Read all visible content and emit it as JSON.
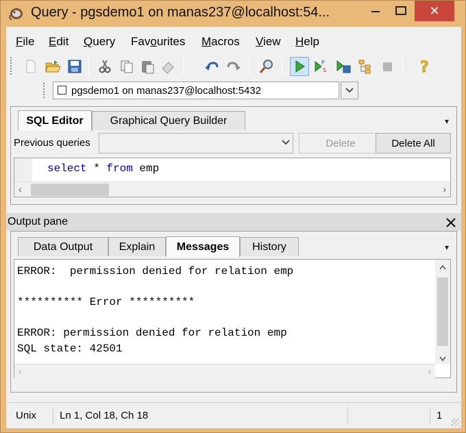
{
  "window": {
    "title": "Query - pgsdemo1 on manas237@localhost:54...",
    "controls": {
      "minimize": "—",
      "maximize": "☐",
      "close": "✕"
    }
  },
  "menu": [
    {
      "label": "File",
      "mnemonic": "F",
      "rest": "ile"
    },
    {
      "label": "Edit",
      "mnemonic": "E",
      "rest": "dit"
    },
    {
      "label": "Query",
      "mnemonic": "Q",
      "rest": "uery"
    },
    {
      "label": "Favourites",
      "pre": "Fav",
      "mnemonic": "o",
      "rest": "urites"
    },
    {
      "label": "Macros",
      "mnemonic": "M",
      "rest": "acros"
    },
    {
      "label": "View",
      "mnemonic": "V",
      "rest": "iew"
    },
    {
      "label": "Help",
      "mnemonic": "H",
      "rest": "elp"
    }
  ],
  "toolbar": {
    "icons": [
      "new-icon",
      "open-folder-icon",
      "save-icon",
      "cut-icon",
      "copy-icon",
      "paste-icon",
      "clear-icon",
      "undo-icon",
      "redo-icon",
      "find-icon",
      "execute-icon",
      "execute-pgscript-icon",
      "execute-to-file-icon",
      "explain-icon",
      "cancel-query-icon",
      "help-icon"
    ]
  },
  "connection": {
    "value": "pgsdemo1 on manas237@localhost:5432"
  },
  "sql_panel": {
    "tabs": [
      "SQL Editor",
      "Graphical Query Builder"
    ],
    "active_tab": "SQL Editor",
    "previous_queries_label": "Previous queries",
    "previous_queries_value": "",
    "delete_label": "Delete",
    "delete_all_label": "Delete All",
    "code": {
      "keyword1": "select",
      "rest1": " * ",
      "keyword2": "from",
      "rest2": " emp"
    }
  },
  "output": {
    "title": "Output pane",
    "tabs": [
      "Data Output",
      "Explain",
      "Messages",
      "History"
    ],
    "active_tab": "Messages",
    "messages": "ERROR:  permission denied for relation emp\n\n********** Error **********\n\nERROR: permission denied for relation emp\nSQL state: 42501"
  },
  "status": {
    "line_endings": "Unix",
    "position": "Ln 1, Col 18, Ch 18",
    "count": "1"
  },
  "colors": {
    "title_bar": "#e8b978",
    "close_button": "#c9463d",
    "sql_keyword": "#0000c0"
  }
}
